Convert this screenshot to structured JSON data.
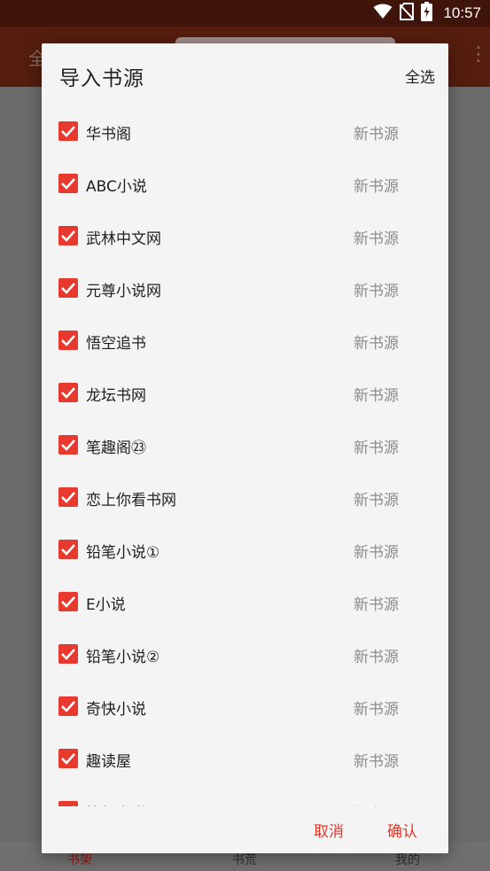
{
  "status_bar": {
    "time": "10:57",
    "icons": [
      "wifi-icon",
      "no-sim-icon",
      "battery-charging-icon"
    ]
  },
  "background_app": {
    "toolbar_title": "全",
    "bottom_nav": [
      "书架",
      "书荒",
      "我的"
    ],
    "active_tab": "书架"
  },
  "dialog": {
    "title": "导入书源",
    "select_all": "全选",
    "items": [
      {
        "name": "华书阁",
        "tag": "新书源",
        "checked": true
      },
      {
        "name": " ABC小说",
        "tag": "新书源",
        "checked": true
      },
      {
        "name": "武林中文网",
        "tag": "新书源",
        "checked": true
      },
      {
        "name": " 元尊小说网",
        "tag": "新书源",
        "checked": true
      },
      {
        "name": "悟空追书",
        "tag": "新书源",
        "checked": true
      },
      {
        "name": "龙坛书网",
        "tag": "新书源",
        "checked": true
      },
      {
        "name": "笔趣阁㉓",
        "tag": "新书源",
        "checked": true
      },
      {
        "name": "恋上你看书网",
        "tag": "新书源",
        "checked": true
      },
      {
        "name": "铅笔小说①",
        "tag": "新书源",
        "checked": true
      },
      {
        "name": "E小说",
        "tag": "新书源",
        "checked": true
      },
      {
        "name": "铅笔小说②",
        "tag": "新书源",
        "checked": true
      },
      {
        "name": "奇快小说",
        "tag": "新书源",
        "checked": true
      },
      {
        "name": "趣读屋",
        "tag": "新书源",
        "checked": true
      },
      {
        "name": "笔趣文学",
        "tag": "新书源",
        "checked": true
      }
    ],
    "cancel_label": "取消",
    "confirm_label": "确认"
  },
  "colors": {
    "accent": "#e8392f",
    "status_bar": "#3f140a",
    "toolbar": "#541d0e",
    "dialog_bg": "#f4f4f4",
    "scrim": "#6b6b6b"
  }
}
